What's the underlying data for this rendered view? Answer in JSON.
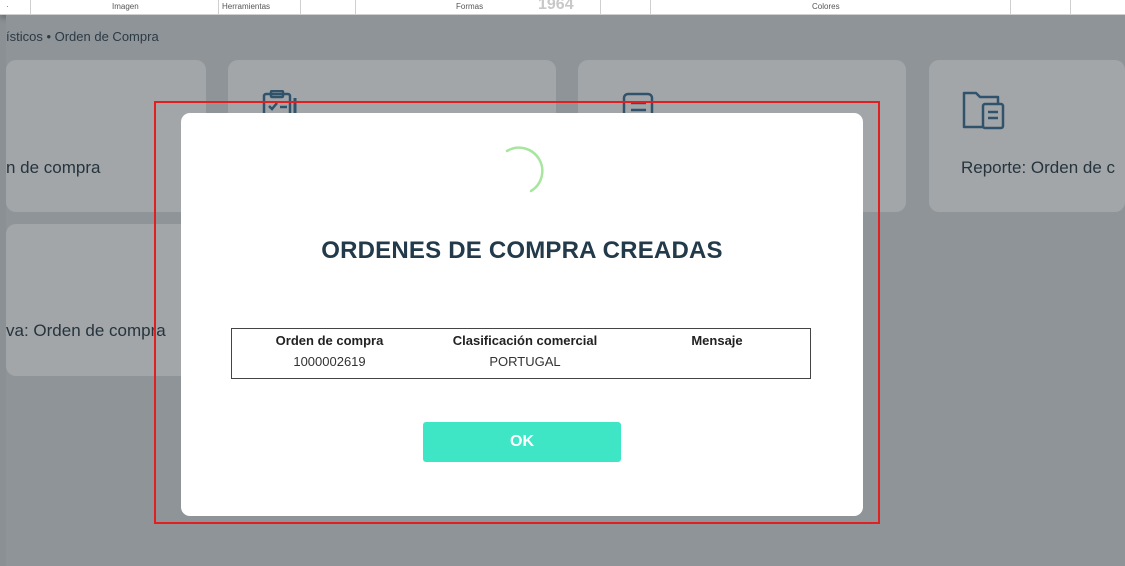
{
  "ribbon": {
    "items": [
      "Imagen",
      "Herramientas",
      "Formas",
      "Colores"
    ],
    "year": "1964"
  },
  "breadcrumb": "ísticos  •  Orden de Compra",
  "cards": [
    {
      "label": "n de compra",
      "icon": "document-icon"
    },
    {
      "label": "",
      "icon": "clipboard-checklist-icon"
    },
    {
      "label": "",
      "icon": "document-list-icon"
    },
    {
      "label": "Reporte: Orden de c",
      "icon": "folder-document-icon"
    },
    {
      "label": "va: Orden de compra",
      "icon": ""
    }
  ],
  "modal": {
    "title": "ORDENES DE COMPRA CREADAS",
    "table": {
      "headers": [
        "Orden de compra",
        "Clasificación comercial",
        "Mensaje"
      ],
      "rows": [
        [
          "1000002619",
          "PORTUGAL",
          ""
        ]
      ]
    },
    "ok_label": "OK"
  },
  "colors": {
    "accent": "#3ee6c6",
    "title": "#233a4a",
    "highlight": "#e02020",
    "overlay": "#8f9498"
  }
}
